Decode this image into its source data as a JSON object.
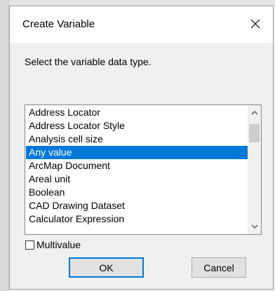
{
  "dialog": {
    "title": "Create Variable",
    "instruction": "Select the variable data type."
  },
  "list": {
    "items": [
      "Address Locator",
      "Address Locator Style",
      "Analysis cell size",
      "Any value",
      "ArcMap Document",
      "Areal unit",
      "Boolean",
      "CAD Drawing Dataset",
      "Calculator Expression"
    ],
    "selected": "Any value"
  },
  "multivalue": {
    "label": "Multivalue",
    "checked": false
  },
  "buttons": {
    "ok": "OK",
    "cancel": "Cancel"
  },
  "colors": {
    "selection": "#0078d7",
    "default_button_border": "#0078d7"
  },
  "icons": {
    "close": "close-icon",
    "scroll_up": "chevron-up-icon",
    "scroll_down": "chevron-down-icon"
  }
}
